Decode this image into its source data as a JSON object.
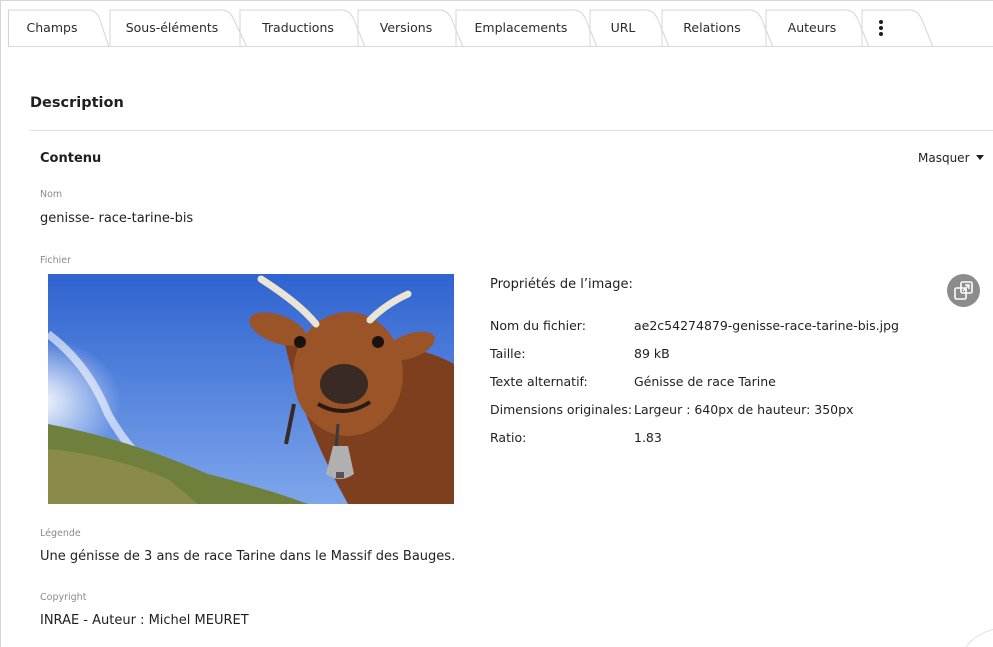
{
  "tabs": [
    {
      "label": "Champs",
      "active": true
    },
    {
      "label": "Sous-éléments"
    },
    {
      "label": "Traductions"
    },
    {
      "label": "Versions"
    },
    {
      "label": "Emplacements"
    },
    {
      "label": "URL"
    },
    {
      "label": "Relations"
    },
    {
      "label": "Auteurs"
    }
  ],
  "more_tabs_icon": "kebab-vertical-icon",
  "section": {
    "title": "Description"
  },
  "group": {
    "title": "Contenu",
    "toggle_label": "Masquer"
  },
  "fields": {
    "name": {
      "label": "Nom",
      "value": "genisse- race-tarine-bis"
    },
    "file": {
      "label": "Fichier"
    },
    "caption": {
      "label": "Légende",
      "value": "Une génisse de 3 ans de race Tarine dans le Massif des Bauges."
    },
    "copyright": {
      "label": "Copyright",
      "value": "INRAE - Auteur : Michel MEURET"
    }
  },
  "image_properties": {
    "title": "Propriétés de l’image:",
    "rows": [
      {
        "key": "Nom du fichier:",
        "value": "ae2c54274879-genisse-race-tarine-bis.jpg"
      },
      {
        "key": "Taille:",
        "value": "89 kB"
      },
      {
        "key": "Texte alternatif:",
        "value": "Génisse de race Tarine"
      },
      {
        "key": "Dimensions originales:",
        "value": "Largeur : 640px de hauteur: 350px"
      },
      {
        "key": "Ratio:",
        "value": "1.83"
      }
    ],
    "expand_icon": "expand-window-icon"
  },
  "colors": {
    "tab_border": "#d4d4d4",
    "text": "#1f1f1f",
    "muted_label": "#8a8a8a",
    "sky": "#3f74d6",
    "cow": "#8a4a24"
  }
}
